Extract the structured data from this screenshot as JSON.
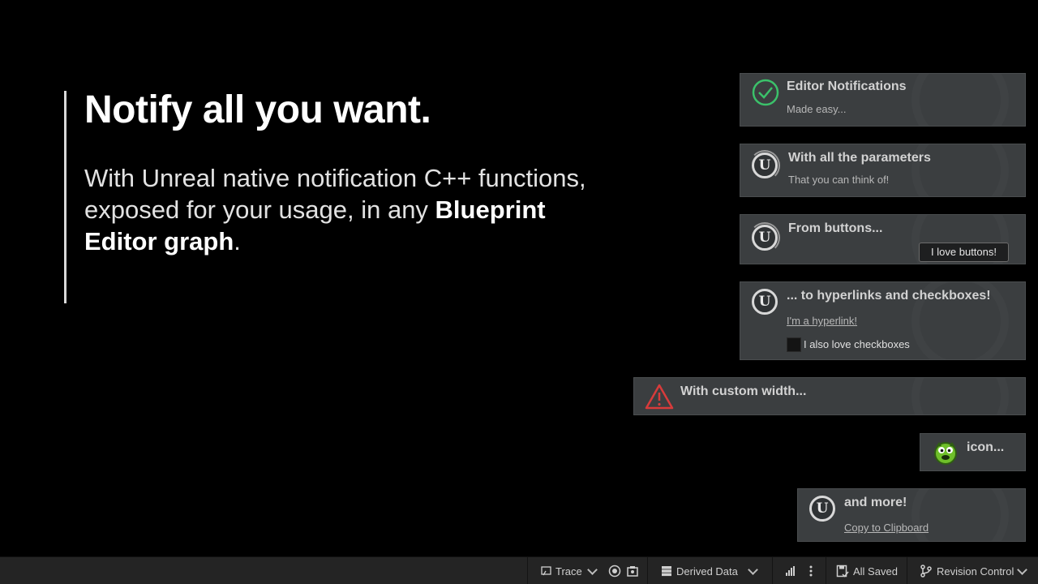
{
  "hero": {
    "title": "Notify all you want.",
    "body_part1": "With Unreal native notification C++ functions, exposed for your usage, in any ",
    "body_strong": "Blueprint Editor graph",
    "body_end": "."
  },
  "notifications": [
    {
      "title": "Editor Notifications",
      "subtitle": "Made easy..."
    },
    {
      "title": "With all the parameters",
      "subtitle": "That you can think of!"
    },
    {
      "title": "From buttons...",
      "button": "I love buttons!"
    },
    {
      "title": "... to hyperlinks and checkboxes!",
      "hyperlink": "I'm a hyperlink!",
      "checkbox_label": "I also love checkboxes"
    },
    {
      "title": "With custom width..."
    },
    {
      "title": "icon..."
    },
    {
      "title": "and more!",
      "hyperlink": "Copy to Clipboard"
    }
  ],
  "statusbar": {
    "trace": "Trace",
    "derived_data": "Derived Data",
    "saved": "All Saved",
    "revision_control": "Revision Control"
  },
  "colors": {
    "success": "#3bc16a",
    "warning": "#d83b3b",
    "card_bg": "#3b3e40"
  }
}
